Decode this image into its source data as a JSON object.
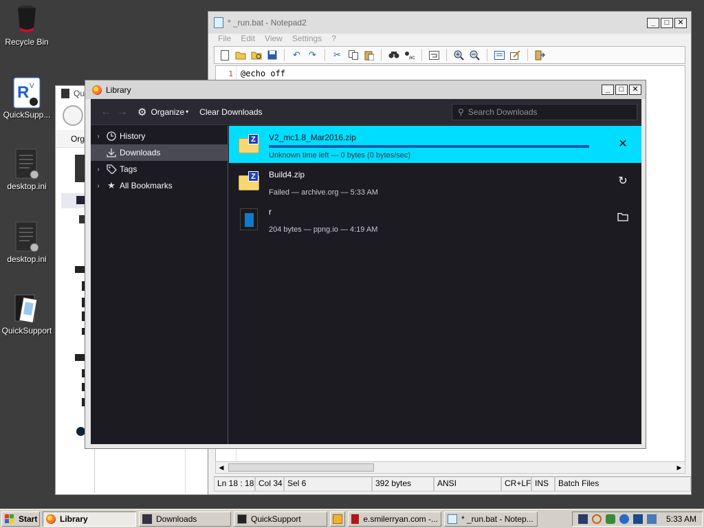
{
  "desktop": {
    "icons": [
      {
        "label": "Recycle Bin"
      },
      {
        "label": "QuickSupp..."
      },
      {
        "label": "desktop.ini"
      },
      {
        "label": "desktop.ini"
      },
      {
        "label": "QuickSupport"
      }
    ]
  },
  "explorer": {
    "title": "Qu",
    "toolbar_label": "Org"
  },
  "notepad": {
    "title": "* _run.bat - Notepad2",
    "menu": [
      "File",
      "Edit",
      "View",
      "Settings",
      "?"
    ],
    "line_number": "1",
    "line_text": "@echo off",
    "status": {
      "position": "Ln 18 : 18",
      "column": "Col 34",
      "selection": "Sel 6",
      "size": "392 bytes",
      "encoding": "ANSI",
      "line_endings": "CR+LF",
      "mode": "INS",
      "lexer": "Batch Files"
    }
  },
  "library": {
    "title": "Library",
    "toolbar": {
      "organize": "Organize",
      "clear": "Clear Downloads",
      "search_placeholder": "Search Downloads"
    },
    "sidebar": [
      {
        "label": "History",
        "icon": "clock-icon",
        "expandable": true,
        "selected": false
      },
      {
        "label": "Downloads",
        "icon": "download-icon",
        "expandable": false,
        "selected": true
      },
      {
        "label": "Tags",
        "icon": "tag-icon",
        "expandable": true,
        "selected": false
      },
      {
        "label": "All Bookmarks",
        "icon": "star-icon",
        "expandable": true,
        "selected": false
      }
    ],
    "downloads": [
      {
        "name": "V2_mc1.8_Mar2016.zip",
        "status": "Unknown time left — 0 bytes (0 bytes/sec)",
        "progress": 1.0,
        "action": "cancel-icon",
        "selected": true
      },
      {
        "name": "Build4.zip",
        "status": "Failed — archive.org — 5:33 AM",
        "action": "retry-icon",
        "selected": false
      },
      {
        "name": "r",
        "status": "204 bytes — ppng.io — 4:19 AM",
        "action": "folder-icon",
        "selected": false
      }
    ]
  },
  "taskbar": {
    "start": "Start",
    "items": [
      {
        "label": "Library",
        "active": true
      },
      {
        "label": "Downloads",
        "active": false
      },
      {
        "label": "QuickSupport",
        "active": false
      },
      {
        "label": "e.smilerryan.com -...",
        "active": false
      },
      {
        "label": "* _run.bat - Notep...",
        "active": false
      }
    ],
    "clock": "5:33 AM"
  },
  "colors": {
    "accent": "#00ddff",
    "dark_bg": "#1c1b22",
    "toolbar_bg": "#2b2a33",
    "taskbar": "#d4d0c8"
  }
}
